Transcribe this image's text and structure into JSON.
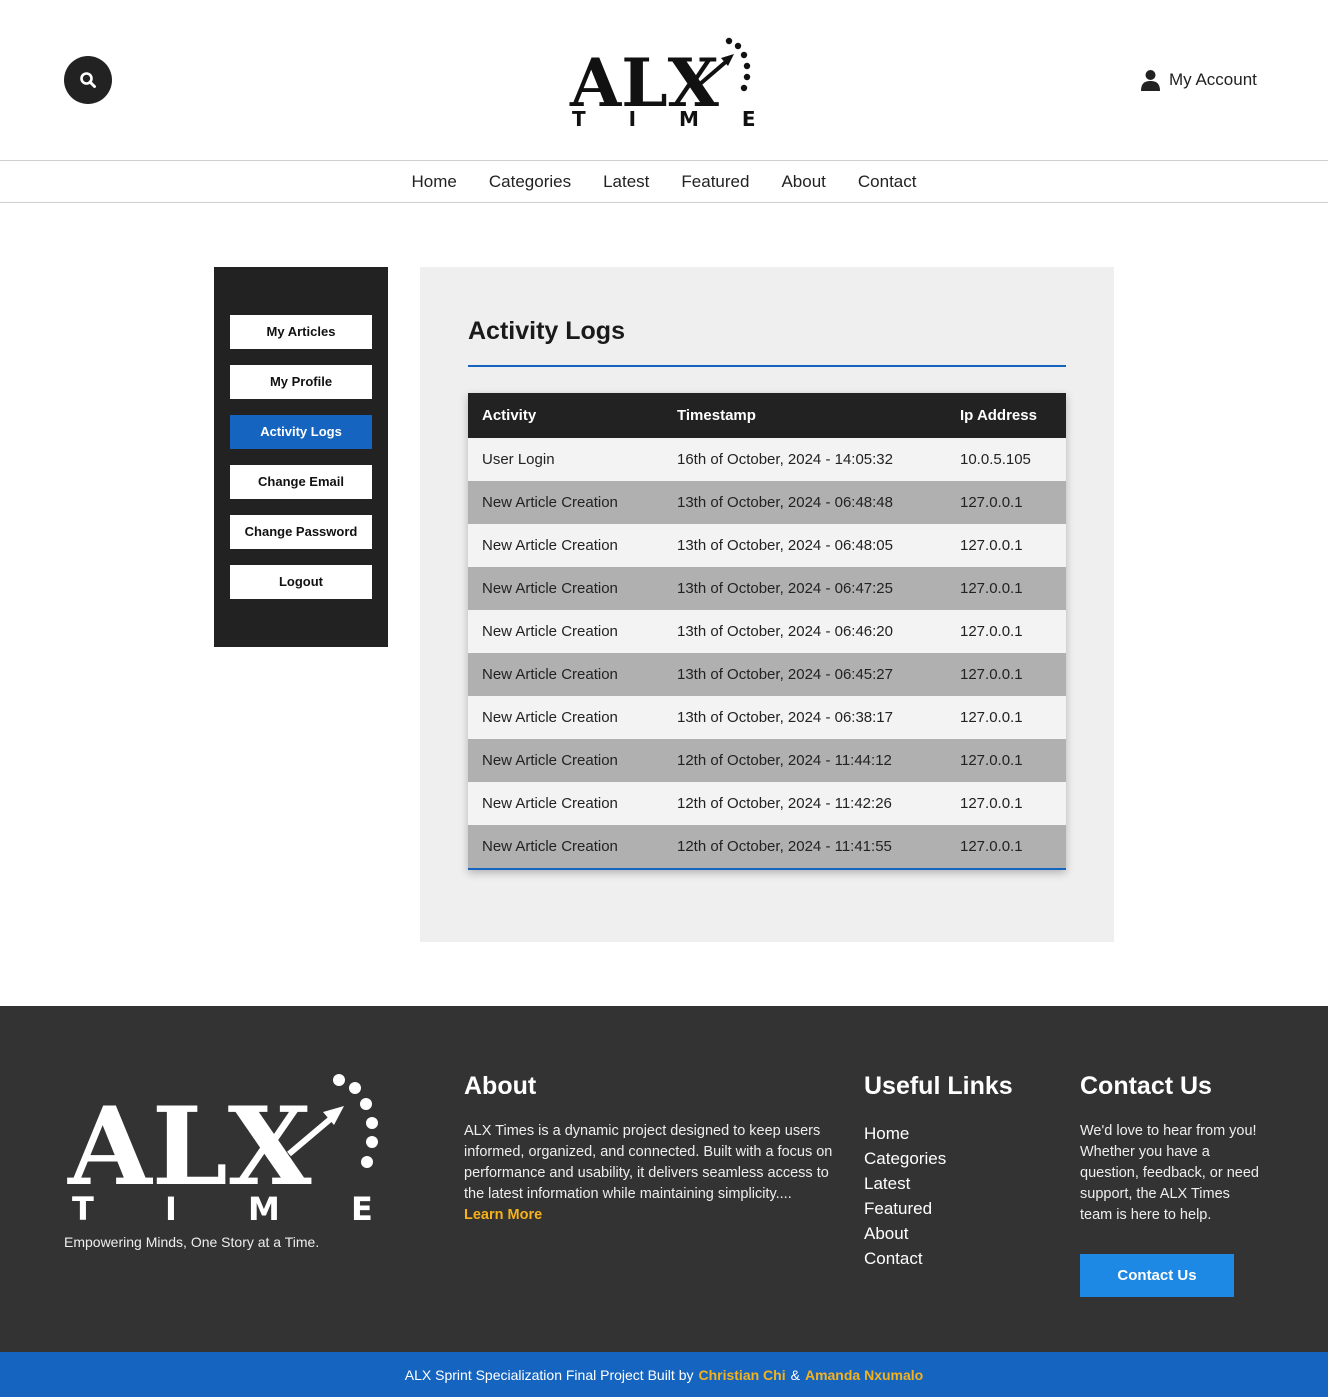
{
  "header": {
    "logo_main": "ALX",
    "logo_sub": "T I M E S",
    "account_label": "My Account",
    "search_icon": "search-icon",
    "account_icon": "user-icon"
  },
  "nav": {
    "items": [
      "Home",
      "Categories",
      "Latest",
      "Featured",
      "About",
      "Contact"
    ]
  },
  "sidebar": {
    "items": [
      "My Articles",
      "My Profile",
      "Activity Logs",
      "Change Email",
      "Change Password",
      "Logout"
    ],
    "active": "Activity Logs"
  },
  "main": {
    "title": "Activity Logs",
    "table": {
      "headers": [
        "Activity",
        "Timestamp",
        "Ip Address"
      ],
      "rows": [
        [
          "User Login",
          "16th of October, 2024 - 14:05:32",
          "10.0.5.105"
        ],
        [
          "New Article Creation",
          "13th of October, 2024 - 06:48:48",
          "127.0.0.1"
        ],
        [
          "New Article Creation",
          "13th of October, 2024 - 06:48:05",
          "127.0.0.1"
        ],
        [
          "New Article Creation",
          "13th of October, 2024 - 06:47:25",
          "127.0.0.1"
        ],
        [
          "New Article Creation",
          "13th of October, 2024 - 06:46:20",
          "127.0.0.1"
        ],
        [
          "New Article Creation",
          "13th of October, 2024 - 06:45:27",
          "127.0.0.1"
        ],
        [
          "New Article Creation",
          "13th of October, 2024 - 06:38:17",
          "127.0.0.1"
        ],
        [
          "New Article Creation",
          "12th of October, 2024 - 11:44:12",
          "127.0.0.1"
        ],
        [
          "New Article Creation",
          "12th of October, 2024 - 11:42:26",
          "127.0.0.1"
        ],
        [
          "New Article Creation",
          "12th of October, 2024 - 11:41:55",
          "127.0.0.1"
        ]
      ]
    }
  },
  "footer": {
    "tagline": "Empowering Minds, One Story at a Time.",
    "about_title": "About",
    "about_text": "ALX Times is a dynamic project designed to keep users informed, organized, and connected. Built with a focus on performance and usability, it delivers seamless access to the latest information while maintaining simplicity....",
    "about_more": "Learn More",
    "links_title": "Useful Links",
    "links": [
      "Home",
      "Categories",
      "Latest",
      "Featured",
      "About",
      "Contact"
    ],
    "contact_title": "Contact Us",
    "contact_text": "We'd love to hear from you! Whether you have a question, feedback, or need support, the ALX Times team is here to help.",
    "contact_button": "Contact Us"
  },
  "bottom_bar": {
    "prefix": "ALX Sprint Specialization Final Project Built by",
    "author1": "Christian Chi",
    "sep": "&",
    "author2": "Amanda Nxumalo"
  },
  "colors": {
    "accent": "#1565c0",
    "highlight": "#f6b21b",
    "dark": "#222222",
    "footer_bg": "#333333"
  }
}
